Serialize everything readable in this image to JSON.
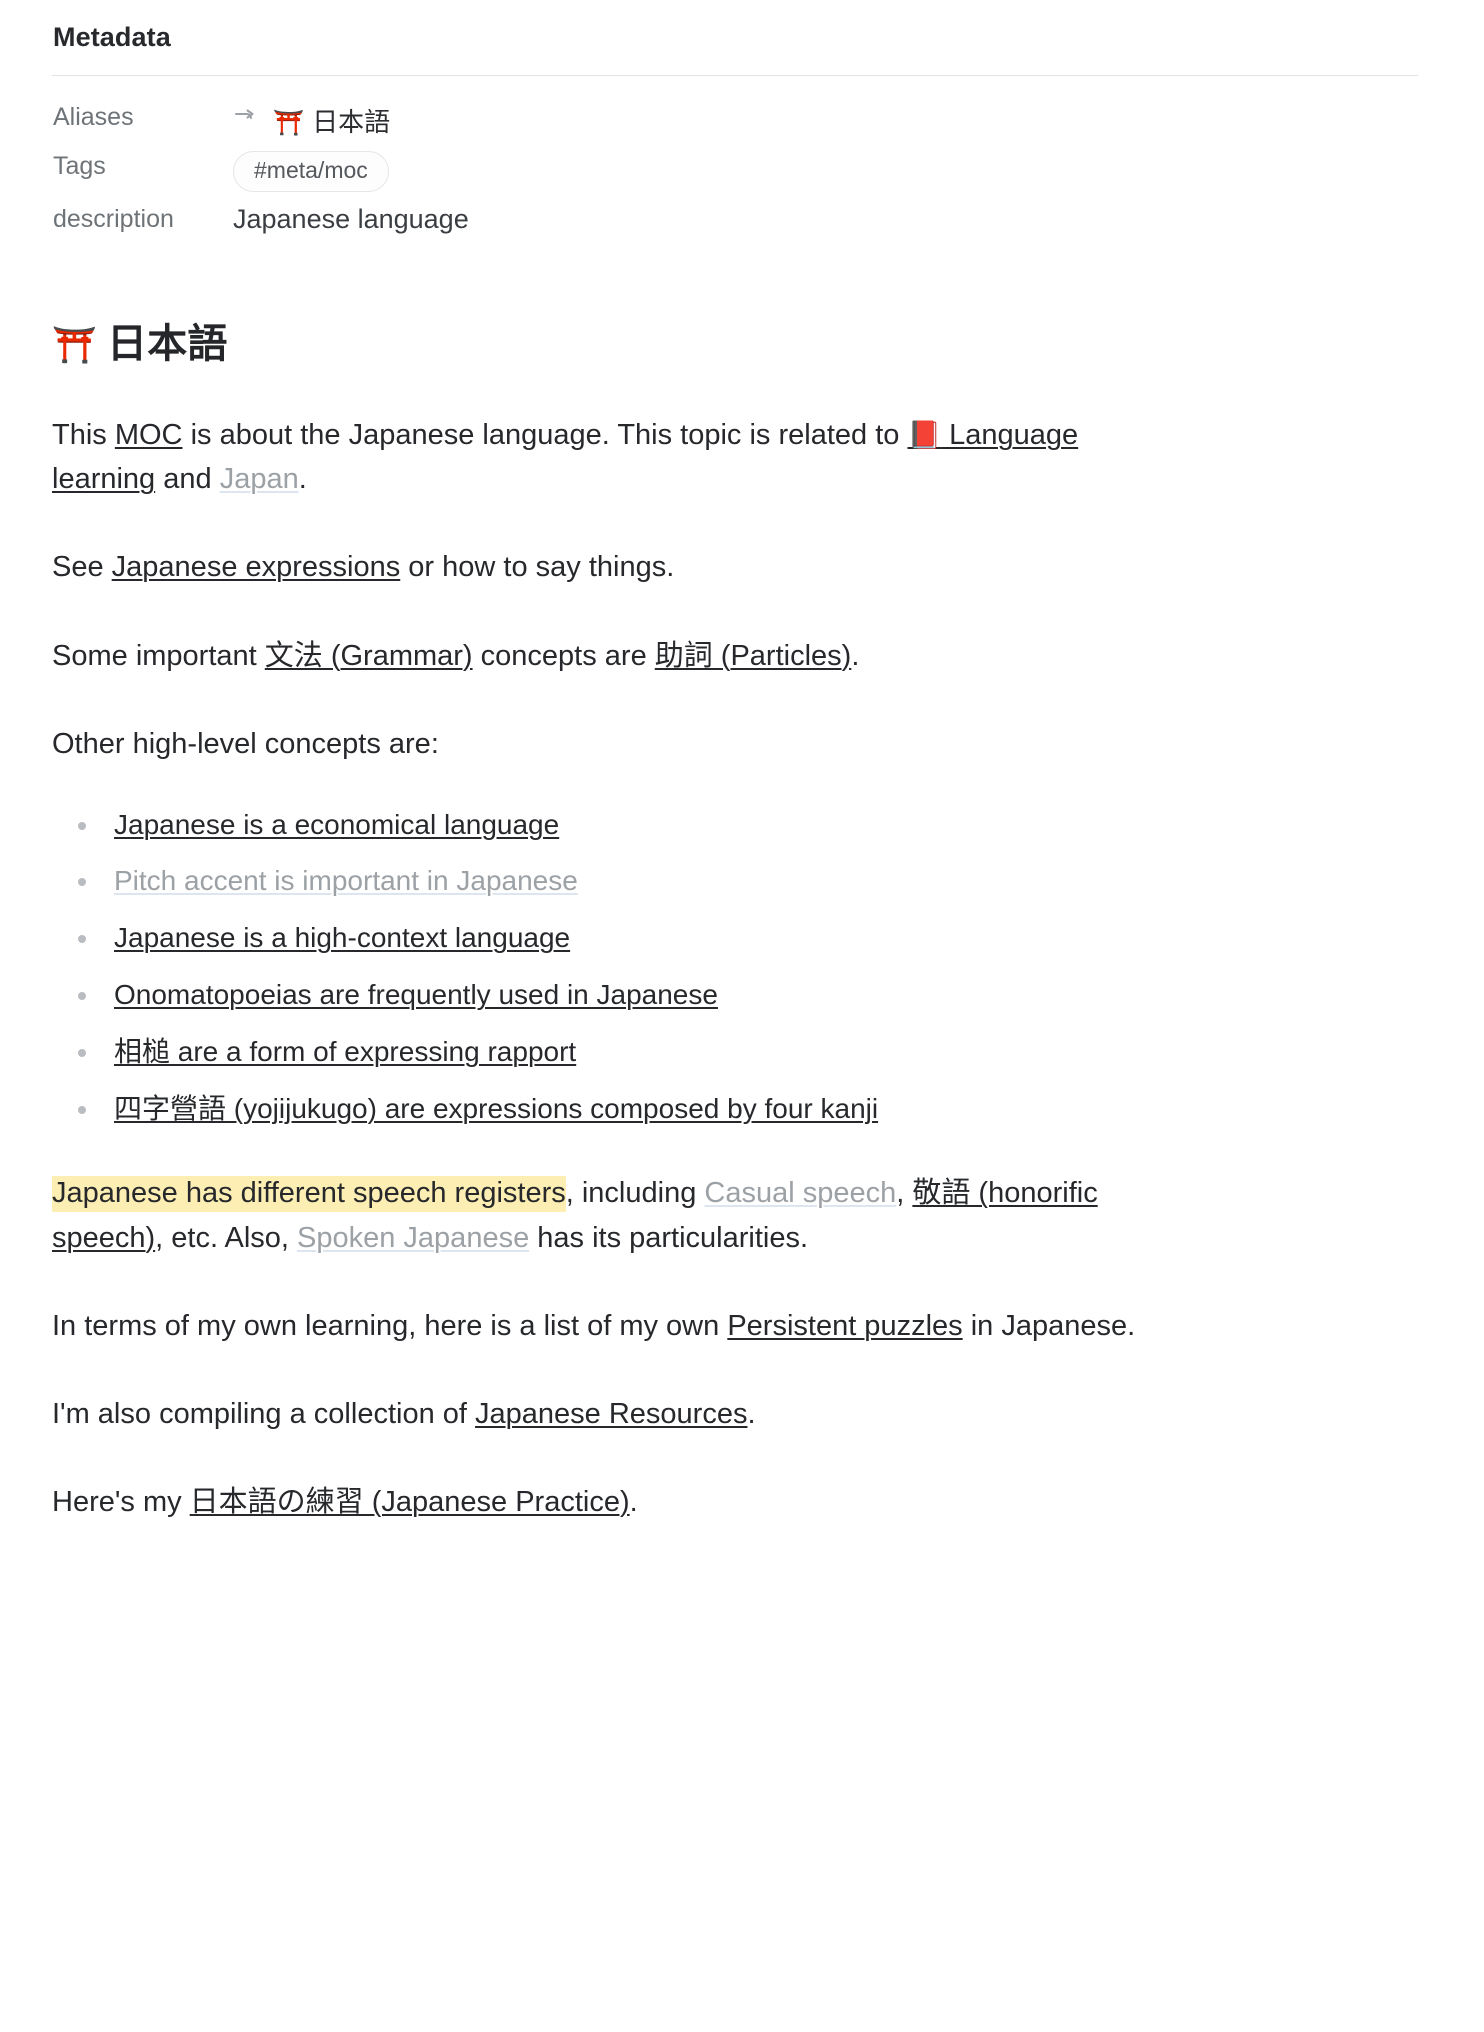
{
  "metadata": {
    "title": "Metadata",
    "rows": {
      "aliases_key": "Aliases",
      "aliases_arrow": "↱",
      "aliases_torii": "⛩️",
      "aliases_value": "日本語",
      "tags_key": "Tags",
      "tags_value": "#meta/moc",
      "description_key": "description",
      "description_value": "Japanese language"
    }
  },
  "heading": {
    "torii": "⛩️",
    "text": "日本語"
  },
  "paragraphs": {
    "p1": {
      "t1": "This ",
      "link_moc": "MOC",
      "t2": " is about the Japanese language. This topic is related to ",
      "book": "📕",
      "link_language_learning": " Language learning",
      "t3": " and ",
      "link_japan": "Japan",
      "t4": "."
    },
    "p2": {
      "t1": "See ",
      "link_japanese_expressions": "Japanese expressions",
      "t2": " or how to say things."
    },
    "p3": {
      "t1": "Some important ",
      "link_grammar": "文法 (Grammar)",
      "t2": " concepts are ",
      "link_particles": "助詞 (Particles)",
      "t3": "."
    },
    "p4": {
      "t1": "Other high-level concepts are:"
    },
    "p5": {
      "highlight": "Japanese has different speech registers",
      "t1": ", including ",
      "link_casual_speech": "Casual speech",
      "t2": ", ",
      "link_keigo": "敬語 (honorific speech)",
      "t3": ", etc. Also, ",
      "link_spoken_japanese": "Spoken Japanese",
      "t4": " has its particularities."
    },
    "p6": {
      "t1": "In terms of my own learning, here is a list of my own ",
      "link_persistent_puzzles": "Persistent puzzles",
      "t2": " in Japanese."
    },
    "p7": {
      "t1": "I'm also compiling a collection of ",
      "link_japanese_resources": "Japanese Resources",
      "t2": "."
    },
    "p8": {
      "t1": "Here's my ",
      "link_japanese_practice": "日本語の練習 (Japanese Practice)",
      "t2": "."
    }
  },
  "bullets": [
    {
      "label": "Japanese is a economical language",
      "state": "resolved"
    },
    {
      "label": "Pitch accent is important in Japanese",
      "state": "unresolved"
    },
    {
      "label": "Japanese is a high-context language",
      "state": "resolved"
    },
    {
      "label": "Onomatopoeias are frequently used in Japanese",
      "state": "resolved"
    },
    {
      "label": "相槌 are a form of expressing rapport",
      "state": "resolved"
    },
    {
      "label": "四字營語 (yojijukugo) are expressions composed by four kanji",
      "state": "resolved"
    }
  ],
  "colors": {
    "highlight": "#fdeeb3",
    "link": "#26282b",
    "unresolved_link": "#9ca1a6",
    "muted_text": "#6e7378"
  }
}
